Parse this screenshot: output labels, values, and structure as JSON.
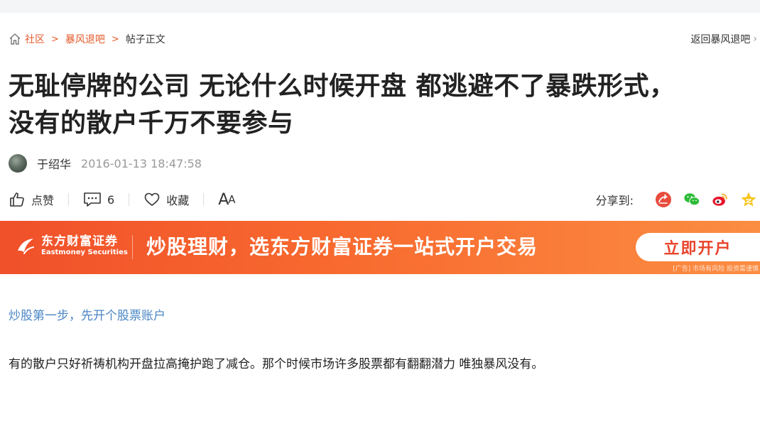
{
  "breadcrumb": {
    "items": [
      "社区",
      "暴风退吧",
      "帖子正文"
    ],
    "back_label": "返回暴风退吧",
    "link_color": "#e55a2b"
  },
  "post": {
    "title_line1": "无耻停牌的公司 无论什么时候开盘 都逃避不了暴跌形式，",
    "title_line2": "没有的散户千万不要参与",
    "author": "于绍华",
    "time": "2016-01-13 18:47:58"
  },
  "actions": {
    "like_label": "点赞",
    "comment_count": "6",
    "favorite_label": "收藏",
    "font_big": "A",
    "font_small": "A"
  },
  "share": {
    "label": "分享到:",
    "icons": [
      "forward-icon",
      "wechat-icon",
      "weibo-icon",
      "qzone-icon"
    ]
  },
  "ad": {
    "brand_cn": "东方财富证券",
    "brand_en": "Eastmoney Securities",
    "slogan": "炒股理财，选东方财富证券一站式开户交易",
    "cta": "立即开户",
    "note": "[广告] 市场有风险 投资需谨慎",
    "gradient_start": "#f0502a",
    "gradient_end": "#fb8d42"
  },
  "content": {
    "promo_link": "炒股第一步，先开个股票账户",
    "paragraph": "有的散户只好祈祷机构开盘拉高掩护跑了减仓。那个时候市场许多股票都有翻翻潜力 唯独暴风没有。"
  }
}
